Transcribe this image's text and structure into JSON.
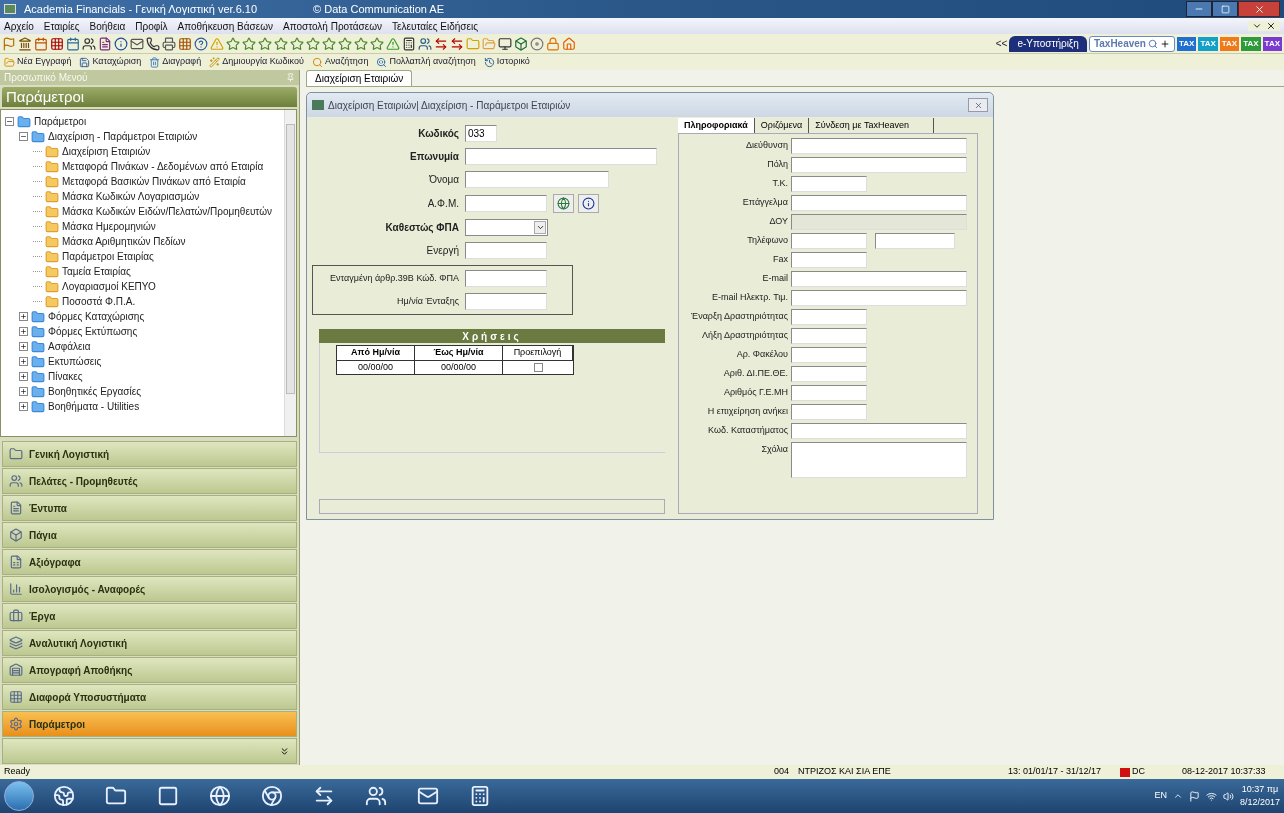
{
  "window": {
    "title": "Academia Financials - Γενική Λογιστική ver.6.10",
    "copyright": "© Data Communication AE"
  },
  "menu": [
    "Αρχείο",
    "Εταιρίες",
    "Βοήθεια",
    "Προφίλ",
    "Αποθήκευση Βάσεων",
    "Αποστολή Προτάσεων",
    "Τελευταίες Ειδήσεις"
  ],
  "support_bar": {
    "collapse": "<<",
    "support": "e-Υποστήριξη",
    "search": "TaxHeaven",
    "badges": [
      {
        "label": "TAX",
        "color": "#1f6fd1"
      },
      {
        "label": "TAX",
        "color": "#12a0c9"
      },
      {
        "label": "TAX",
        "color": "#f07a1a"
      },
      {
        "label": "TAX",
        "color": "#2e9a3a"
      },
      {
        "label": "TAX",
        "color": "#7a3ad1"
      }
    ]
  },
  "actions": [
    "Νέα Εγγραφή",
    "Καταχώριση",
    "Διαγραφή",
    "Δημιουργία Κωδικού",
    "Αναζήτηση",
    "Πολλαπλή αναζήτηση",
    "Ιστορικό"
  ],
  "sidebar": {
    "header": "Προσωπικό Μενού",
    "title": "Παράμετροι",
    "tree": [
      {
        "label": "Παράμετροι",
        "expanded": true,
        "children": [
          {
            "label": "Διαχείριση - Παράμετροι Εταιριών",
            "expanded": true,
            "children": [
              {
                "label": "Διαχείριση Εταιριών"
              },
              {
                "label": "Μεταφορά Πινάκων - Δεδομένων από Εταιρία"
              },
              {
                "label": "Μεταφορά Βασικών Πινάκων από Εταιρία"
              },
              {
                "label": "Μάσκα Κωδικών Λογαριασμών"
              },
              {
                "label": "Μάσκα Κωδικών Ειδών/Πελατών/Προμηθευτών"
              },
              {
                "label": "Μάσκα Ημερομηνιών"
              },
              {
                "label": "Μάσκα Αριθμητικών Πεδίων"
              },
              {
                "label": "Παράμετροι Εταιρίας"
              },
              {
                "label": "Ταμεία Εταιρίας"
              },
              {
                "label": "Λογαριασμοί ΚΕΠΥΟ"
              },
              {
                "label": "Ποσοστά Φ.Π.Α."
              }
            ]
          },
          {
            "label": "Φόρμες Καταχώρισης",
            "expanded": false
          },
          {
            "label": "Φόρμες Εκτύπωσης",
            "expanded": false
          },
          {
            "label": "Ασφάλεια",
            "expanded": false
          },
          {
            "label": "Εκτυπώσεις",
            "expanded": false
          },
          {
            "label": "Πίνακες",
            "expanded": false
          },
          {
            "label": "Βοηθητικές Εργασίες",
            "expanded": false
          },
          {
            "label": "Βοηθήματα - Utilities",
            "expanded": false
          }
        ]
      }
    ],
    "nav": [
      {
        "label": "Γενική Λογιστική",
        "selected": false
      },
      {
        "label": "Πελάτες - Προμηθευτές",
        "selected": false
      },
      {
        "label": "Έντυπα",
        "selected": false
      },
      {
        "label": "Πάγια",
        "selected": false
      },
      {
        "label": "Αξιόγραφα",
        "selected": false
      },
      {
        "label": "Ισολογισμός - Αναφορές",
        "selected": false
      },
      {
        "label": "Έργα",
        "selected": false
      },
      {
        "label": "Αναλυτική Λογιστική",
        "selected": false
      },
      {
        "label": "Απογραφή Αποθήκης",
        "selected": false
      },
      {
        "label": "Διαφορά Υποσυστήματα",
        "selected": false
      },
      {
        "label": "Παράμετροι",
        "selected": true
      }
    ]
  },
  "document_tab": "Διαχείριση Εταιριών",
  "dialog": {
    "title": "Διαχείριση Εταιριών| Διαχείριση - Παράμετροι Εταιριών",
    "fields": [
      {
        "label": "Κωδικός",
        "kind": "code",
        "bold": true,
        "value": "033"
      },
      {
        "label": "Επωνυμία",
        "kind": "long",
        "bold": true
      },
      {
        "label": "Όνομα",
        "kind": "medium",
        "bold": false
      },
      {
        "label": "Α.Φ.Μ.",
        "kind": "taxid",
        "bold": false
      },
      {
        "label": "Καθεστώς ΦΠΑ",
        "kind": "combo",
        "bold": true
      },
      {
        "label": "Ενεργή",
        "kind": "short",
        "bold": false
      }
    ],
    "group_fields": [
      {
        "label": "Ενταγμένη άρθρ.39Β Κώδ. ΦΠΑ"
      },
      {
        "label": "Ημ/νία Ένταξης"
      }
    ],
    "usage": {
      "title": "Χρήσεις",
      "columns": [
        "Από Ημ/νία",
        "Έως Ημ/νία",
        "Προεπιλογή"
      ],
      "rows": [
        {
          "from": "00/00/00",
          "to": "00/00/00",
          "checked": false
        }
      ]
    },
    "tabs": [
      {
        "label": "Πληροφοριακά",
        "selected": true
      },
      {
        "label": "Οριζόμενα",
        "selected": false
      },
      {
        "label": "Σύνδεση με TaxHeaven",
        "selected": false
      }
    ],
    "info_fields": [
      {
        "label": "Διεύθυνση",
        "kind": "long"
      },
      {
        "label": "Πόλη",
        "kind": "long"
      },
      {
        "label": "Τ.Κ.",
        "kind": "short"
      },
      {
        "label": "Επάγγελμα",
        "kind": "long"
      },
      {
        "label": "ΔΟΥ",
        "kind": "disabled"
      },
      {
        "label": "Τηλέφωνο",
        "kind": "pair"
      },
      {
        "label": "Fax",
        "kind": "short"
      },
      {
        "label": "E-mail",
        "kind": "long"
      },
      {
        "label": "E-mail Ηλεκτρ. Τιμ.",
        "kind": "long"
      },
      {
        "label": "Έναρξη Δραστηριότητας",
        "kind": "short"
      },
      {
        "label": "Λήξη Δραστηριότητας",
        "kind": "short"
      },
      {
        "label": "Αρ. Φακέλου",
        "kind": "short"
      },
      {
        "label": "Αριθ. ΔΙ.ΠΕ.ΘΕ.",
        "kind": "short"
      },
      {
        "label": "Αριθμός Γ.Ε.ΜΗ",
        "kind": "short"
      },
      {
        "label": "Η επιχείρηση ανήκει",
        "kind": "short"
      },
      {
        "label": "Κωδ. Καταστήματος",
        "kind": "long"
      },
      {
        "label": "Σχόλια",
        "kind": "memo"
      }
    ]
  },
  "status_bar": {
    "message": "Ready",
    "company_code": "004",
    "company": "ΝΤΡΙΖΟΣ ΚΑΙ ΣΙΑ ΕΠΕ",
    "period": "13: 01/01/17 - 31/12/17",
    "user": "DC",
    "timestamp": "08-12-2017 10:37:33"
  },
  "taskbar": {
    "language": "EN",
    "time": "10:37 πμ",
    "date": "8/12/2017"
  }
}
